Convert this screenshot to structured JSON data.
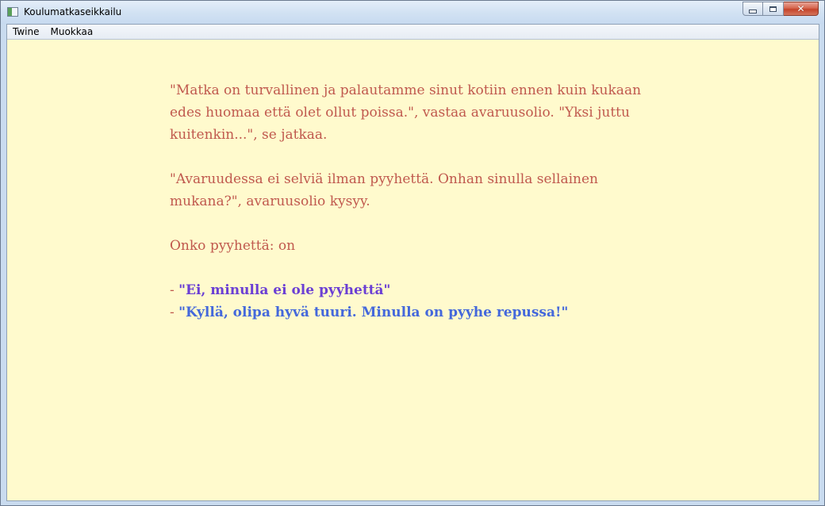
{
  "window": {
    "title": "Koulumatkaseikkailu",
    "controls": {
      "minimize": "minimize",
      "maximize": "maximize",
      "close": "✕"
    }
  },
  "menubar": {
    "items": [
      {
        "label": "Twine"
      },
      {
        "label": "Muokkaa"
      }
    ]
  },
  "story": {
    "paragraphs": [
      "\"Matka on turvallinen ja palautamme sinut kotiin ennen kuin kukaan edes huomaa että olet ollut poissa.\", vastaa avaruusolio. \"Yksi juttu kuitenkin...\", se jatkaa.",
      "\"Avaruudessa ei selviä ilman pyyhettä. Onhan sinulla sellainen mukana?\", avaruusolio kysyy.",
      "Onko pyyhettä: on"
    ],
    "choices": [
      {
        "prefix": "- ",
        "label": "\"Ei, minulla ei ole pyyhettä\""
      },
      {
        "prefix": "- ",
        "label": "\"Kyllä, olipa hyvä tuuri. Minulla on pyyhe repussa!\""
      }
    ]
  },
  "colors": {
    "background": "#fffacd",
    "text": "#c0594e",
    "choice_visited": "#6b3fd4",
    "choice_link": "#4468db"
  }
}
